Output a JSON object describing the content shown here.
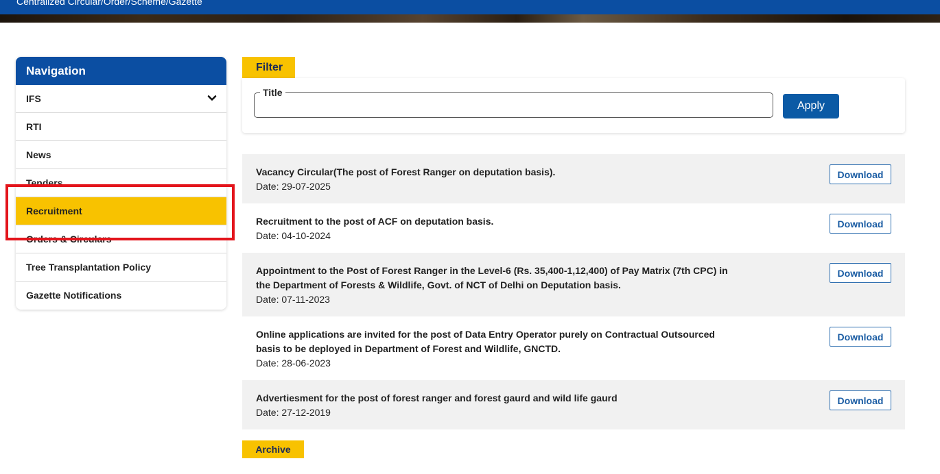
{
  "banner": {
    "text": "Centralized Circular/Order/Scheme/Gazette"
  },
  "sidebar": {
    "header": "Navigation",
    "items": [
      {
        "label": "IFS",
        "has_chevron": true
      },
      {
        "label": "RTI"
      },
      {
        "label": "News"
      },
      {
        "label": "Tenders"
      },
      {
        "label": "Recruitment",
        "active": true
      },
      {
        "label": "Orders & Circulars"
      },
      {
        "label": "Tree Transplantation Policy"
      },
      {
        "label": "Gazette Notifications"
      }
    ]
  },
  "filter": {
    "tab_label": "Filter",
    "title_legend": "Title",
    "title_value": "",
    "apply_label": "Apply"
  },
  "list": {
    "download_label": "Download",
    "items": [
      {
        "title": "Vacancy Circular(The post of Forest Ranger on deputation basis).",
        "date": "Date: 29-07-2025"
      },
      {
        "title": "Recruitment to the post of ACF on deputation basis.",
        "date": "Date: 04-10-2024"
      },
      {
        "title": "Appointment to the Post of Forest Ranger in the Level-6 (Rs. 35,400-1,12,400) of Pay Matrix (7th CPC) in the Department of Forests & Wildlife, Govt. of NCT of Delhi on Deputation basis.",
        "date": "Date: 07-11-2023"
      },
      {
        "title": "Online applications are invited for the post of Data Entry Operator purely on Contractual Outsourced basis to be deployed in Department of Forest and Wildlife, GNCTD.",
        "date": "Date: 28-06-2023"
      },
      {
        "title": "Advertiesment for the post of forest ranger and forest gaurd and wild life gaurd",
        "date": "Date: 27-12-2019"
      }
    ]
  },
  "archive": {
    "label": "Archive"
  },
  "colors": {
    "primary_blue": "#0b4ea2",
    "accent_yellow": "#f8c200",
    "highlight_red": "#e3141b"
  }
}
